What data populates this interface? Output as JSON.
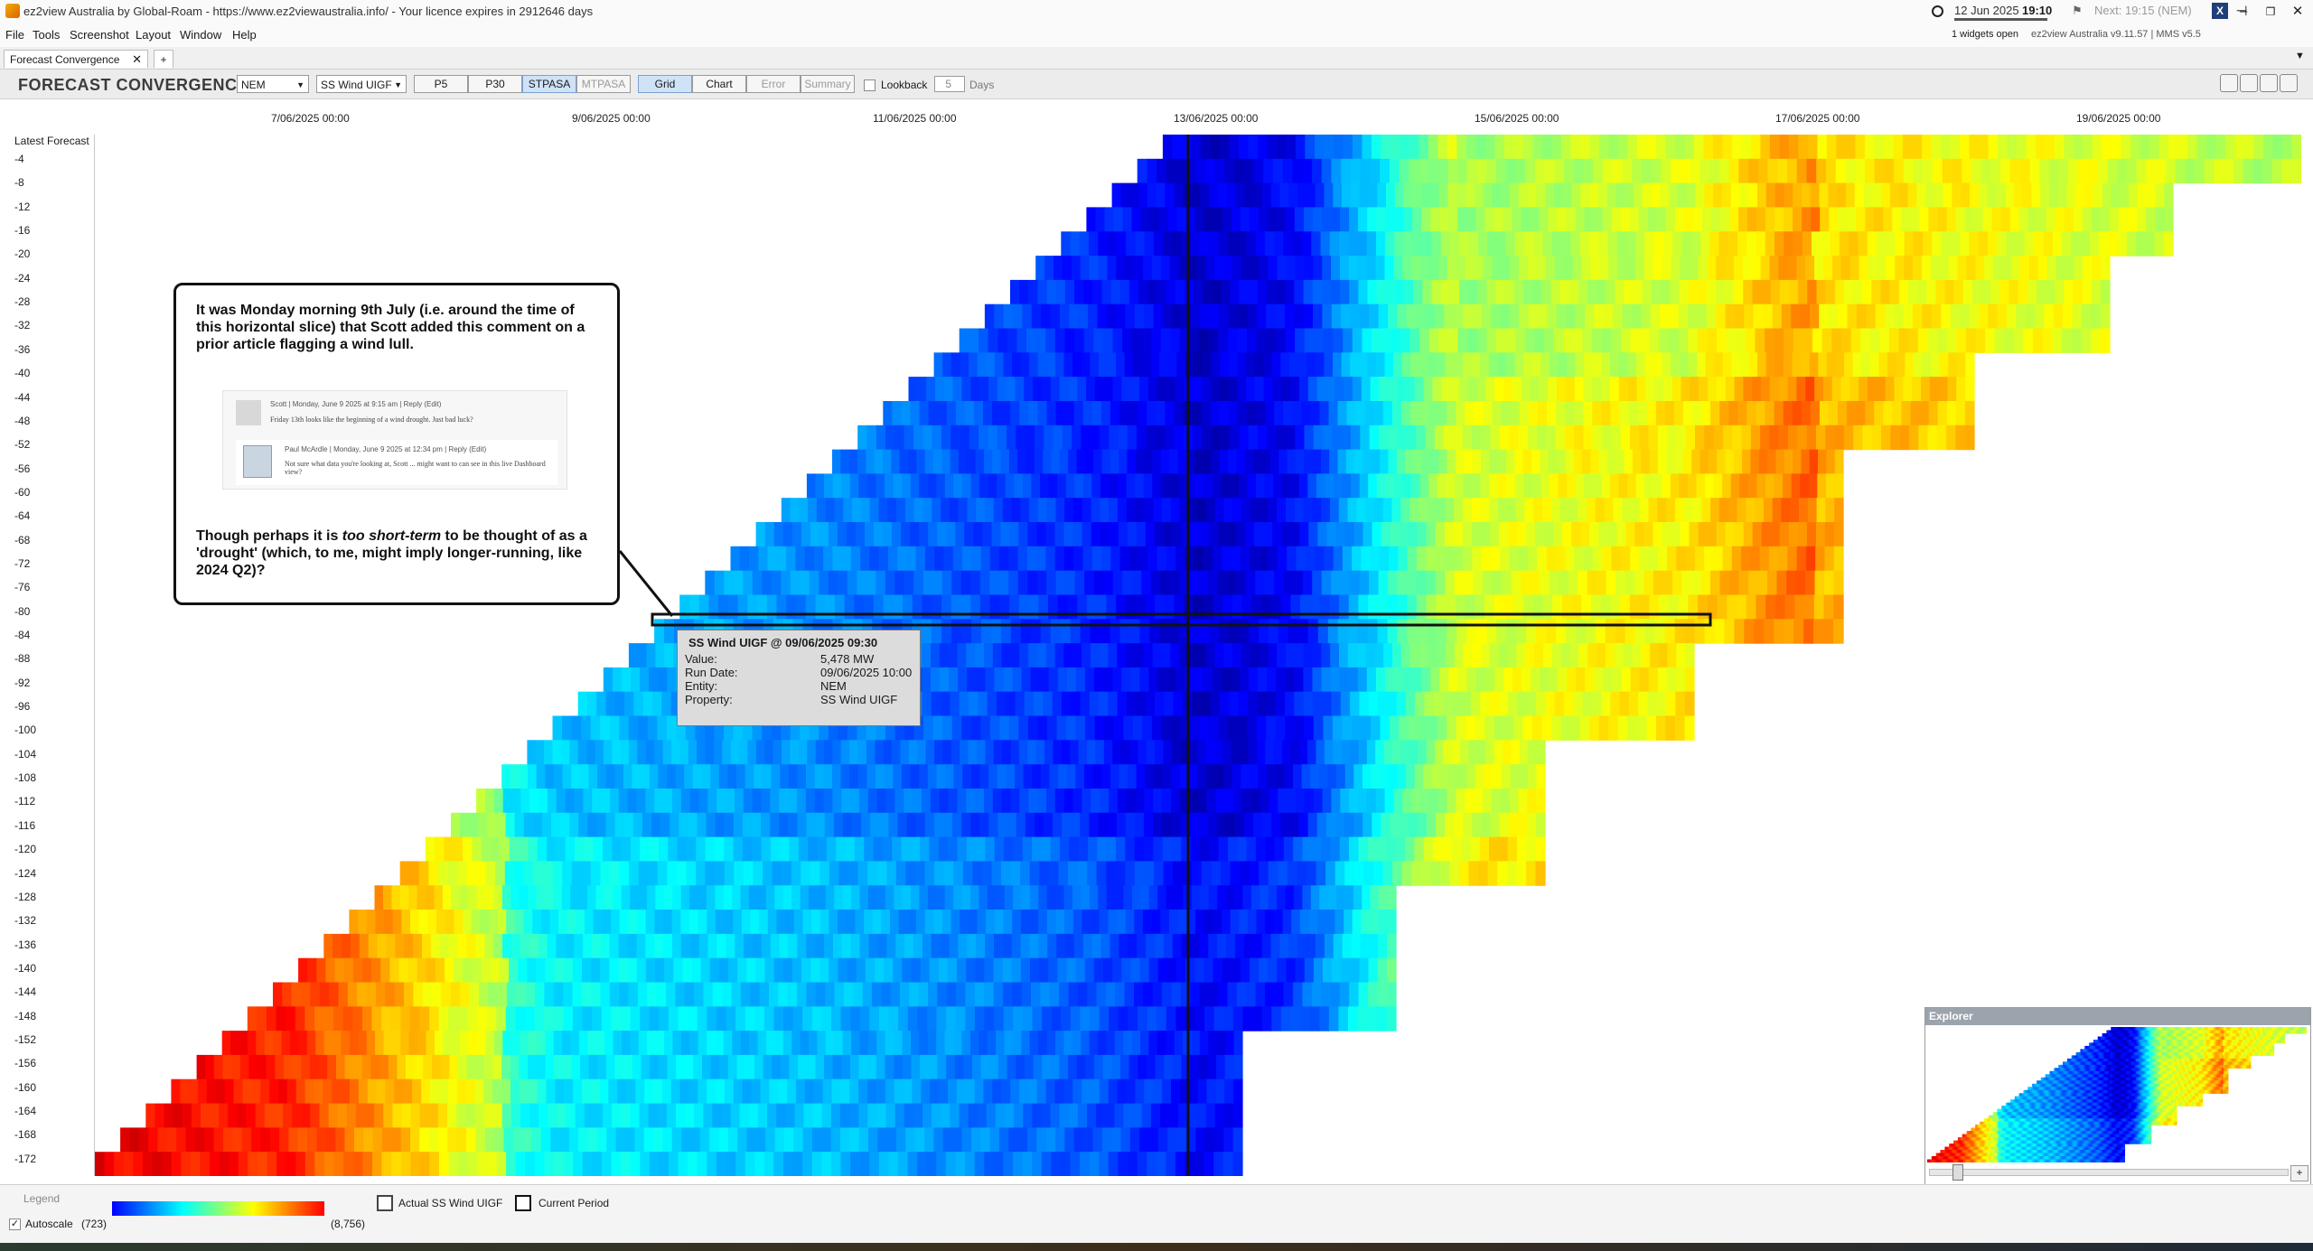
{
  "window": {
    "title": "ez2view Australia by Global-Roam - https://www.ez2viewaustralia.info/ - Your licence expires in 2912646 days",
    "date": "12 Jun 2025",
    "time": "19:10",
    "next": "Next: 19:15 (NEM)",
    "widgets_open": "1 widgets open",
    "version": "ez2view Australia v9.11.57 | MMS v5.5"
  },
  "menu": [
    "File",
    "Tools",
    "Screenshot",
    "Layout",
    "Window",
    "Help"
  ],
  "tabs": {
    "active": "Forecast Convergence",
    "close": "✕",
    "add": "+"
  },
  "toolbar": {
    "title": "FORECAST CONVERGENCE",
    "region": "NEM",
    "measure": "SS Wind UIGF",
    "buttons": [
      "P5",
      "P30",
      "STPASA",
      "MTPASA"
    ],
    "view_buttons": [
      "Grid",
      "Chart",
      "Error",
      "Summary"
    ],
    "lookback_label": "Lookback",
    "lookback_value": "5",
    "days_label": "Days"
  },
  "x_axis": {
    "ticks": [
      "7/06/2025 00:00",
      "9/06/2025 00:00",
      "11/06/2025 00:00",
      "13/06/2025 00:00",
      "15/06/2025 00:00",
      "17/06/2025 00:00",
      "19/06/2025 00:00"
    ]
  },
  "y_axis": {
    "header": "Latest Forecast",
    "ticks": [
      "-4",
      "-8",
      "-12",
      "-16",
      "-20",
      "-24",
      "-28",
      "-32",
      "-36",
      "-40",
      "-44",
      "-48",
      "-52",
      "-56",
      "-60",
      "-64",
      "-68",
      "-72",
      "-76",
      "-80",
      "-84",
      "-88",
      "-92",
      "-96",
      "-100",
      "-104",
      "-108",
      "-112",
      "-116",
      "-120",
      "-124",
      "-128",
      "-132",
      "-136",
      "-140",
      "-144",
      "-148",
      "-152",
      "-156",
      "-160",
      "-164",
      "-168",
      "-172"
    ]
  },
  "callout": {
    "p1": "It was Monday morning 9th July (i.e. around the time of this horizontal slice) that Scott added this comment on a prior article flagging a wind lull.",
    "p2_pre": "Though perhaps it is ",
    "p2_em": "too short-term",
    "p2_post": " to be thought of as a 'drought' (which, to me, might imply longer-running, like 2024 Q2)?",
    "comment1_meta": "Scott | Monday, June 9 2025 at 9:15 am | Reply (Edit)",
    "comment1_text": "Friday 13th looks like the beginning of a wind drought. Just bad luck?",
    "comment2_meta": "Paul McArdle | Monday, June 9 2025 at 12:34 pm | Reply (Edit)",
    "comment2_text": "Not sure what data you're looking at, Scott ... might want to can see in this live Dashboard view?"
  },
  "tooltip": {
    "title": "SS Wind UIGF @ 09/06/2025 09:30",
    "rows": [
      {
        "label": "Value:",
        "value": "5,478 MW"
      },
      {
        "label": "Run Date:",
        "value": "09/06/2025 10:00"
      },
      {
        "label": "Entity:",
        "value": "NEM"
      },
      {
        "label": "Property:",
        "value": "SS Wind UIGF"
      }
    ]
  },
  "legend": {
    "label": "Legend",
    "autoscale": "Autoscale",
    "min": "(723)",
    "max": "(8,756)",
    "actual": "Actual SS Wind UIGF",
    "current": "Current Period"
  },
  "explorer": {
    "title": "Explorer"
  },
  "colors": {
    "accent": "#cfe2f7",
    "low": "#0000ff",
    "high": "#ff0000"
  }
}
